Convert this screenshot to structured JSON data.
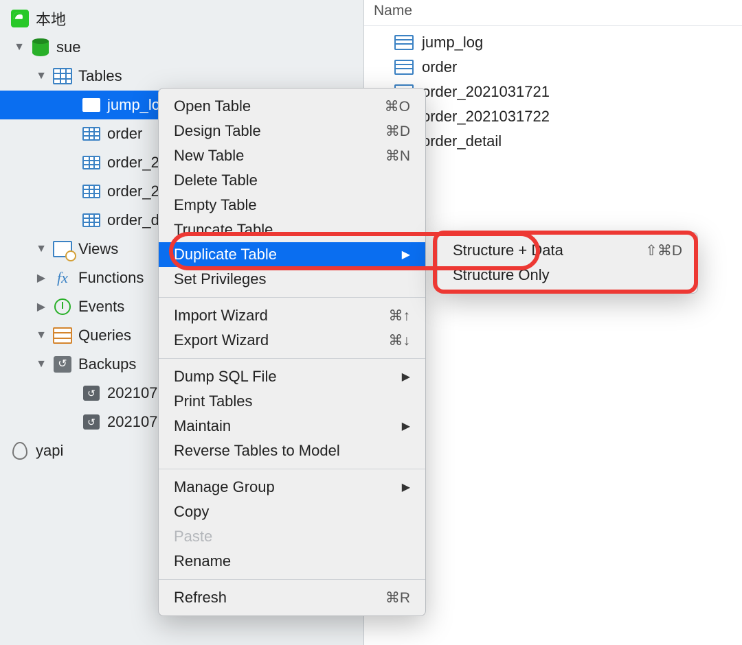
{
  "sidebar": {
    "connection": "本地",
    "database": "sue",
    "groups": {
      "tables": "Tables",
      "views": "Views",
      "functions": "Functions",
      "events": "Events",
      "queries": "Queries",
      "backups": "Backups"
    },
    "tables": [
      "jump_log",
      "order",
      "order_2",
      "order_2",
      "order_d"
    ],
    "backups": [
      "202107",
      "202107"
    ],
    "other_conn": "yapi"
  },
  "main": {
    "header": "Name",
    "tables": [
      "jump_log",
      "order",
      "order_2021031721",
      "order_2021031722",
      "order_detail"
    ]
  },
  "menu": {
    "open_table": "Open Table",
    "design_table": "Design Table",
    "new_table": "New Table",
    "delete_table": "Delete Table",
    "empty_table": "Empty Table",
    "truncate_table": "Truncate Table",
    "duplicate_table": "Duplicate Table",
    "set_privileges": "Set Privileges",
    "import_wizard": "Import Wizard",
    "export_wizard": "Export Wizard",
    "dump_sql": "Dump SQL File",
    "print_tables": "Print Tables",
    "maintain": "Maintain",
    "reverse": "Reverse Tables to Model",
    "manage_group": "Manage Group",
    "copy": "Copy",
    "paste": "Paste",
    "rename": "Rename",
    "refresh": "Refresh",
    "sc_open": "⌘O",
    "sc_design": "⌘D",
    "sc_new": "⌘N",
    "sc_import": "⌘↑",
    "sc_export": "⌘↓",
    "sc_refresh": "⌘R"
  },
  "submenu": {
    "structure_data": "Structure + Data",
    "structure_only": "Structure Only",
    "sc_sd": "⇧⌘D"
  }
}
